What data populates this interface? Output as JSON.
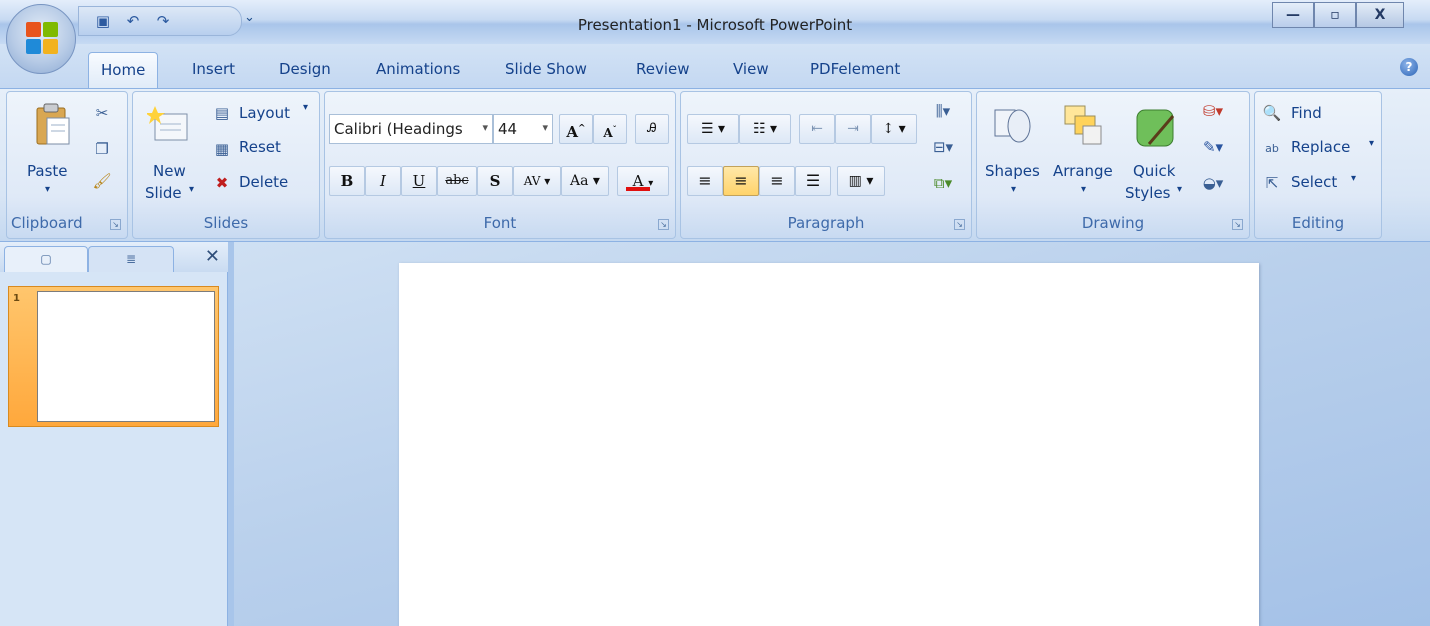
{
  "window": {
    "title": "Presentation1 - Microsoft PowerPoint",
    "controls": [
      "minimize-icon",
      "restore-icon",
      "close-icon"
    ]
  },
  "quick_access": {
    "items": [
      "save-icon",
      "undo-icon",
      "redo-icon"
    ],
    "dropdown": "⌄"
  },
  "tabs": [
    {
      "label": "Home",
      "active": true
    },
    {
      "label": "Insert"
    },
    {
      "label": "Design"
    },
    {
      "label": "Animations"
    },
    {
      "label": "Slide Show"
    },
    {
      "label": "Review"
    },
    {
      "label": "View"
    },
    {
      "label": "PDFelement"
    }
  ],
  "ribbon": {
    "clipboard": {
      "label": "Clipboard",
      "paste": "Paste"
    },
    "slides": {
      "label": "Slides",
      "new_slide_1": "New",
      "new_slide_2": "Slide",
      "layout": "Layout",
      "reset": "Reset",
      "delete": "Delete"
    },
    "font": {
      "label": "Font",
      "font_name": "Calibri (Headings",
      "font_size": "44",
      "bold": "B",
      "italic": "I",
      "underline": "U",
      "strike": "abc",
      "shadow": "S",
      "spacing": "AV",
      "change_case": "Aa",
      "font_color": "A",
      "grow": "A",
      "shrink": "A"
    },
    "paragraph": {
      "label": "Paragraph"
    },
    "drawing": {
      "label": "Drawing",
      "shapes": "Shapes",
      "arrange": "Arrange",
      "quick_1": "Quick",
      "quick_2": "Styles"
    },
    "editing": {
      "label": "Editing",
      "find": "Find",
      "replace": "Replace",
      "select": "Select"
    }
  },
  "slides_pane": {
    "slide_number": "1"
  },
  "colors": {
    "accent": "#15428b",
    "selected_thumb": "#ffa83c",
    "font_color_bar": "#e01010"
  }
}
